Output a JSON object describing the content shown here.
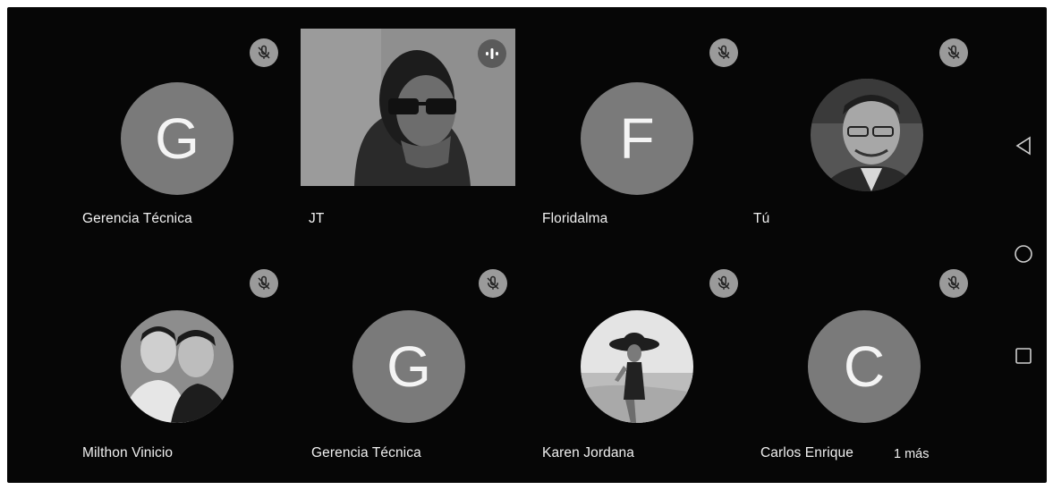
{
  "participants": [
    {
      "name": "Gerencia Técnica",
      "initial": "G"
    },
    {
      "name": "JT"
    },
    {
      "name": "Floridalma",
      "initial": "F"
    },
    {
      "name": "Tú"
    },
    {
      "name": "Milthon Vinicio"
    },
    {
      "name": "Gerencia Técnica",
      "initial": "G"
    },
    {
      "name": "Karen Jordana"
    },
    {
      "name": "Carlos Enrique",
      "initial": "C"
    }
  ],
  "more_label": "1 más",
  "colors": {
    "background": "#060606",
    "avatar": "#7a7a7a",
    "mic_badge": "#9a9a9a",
    "text": "#f0f0f0"
  },
  "icons": {
    "muted": "mic-off-icon",
    "speaking": "audio-level-icon",
    "nav_back": "back-triangle-icon",
    "nav_home": "home-circle-icon",
    "nav_recents": "recents-square-icon"
  }
}
